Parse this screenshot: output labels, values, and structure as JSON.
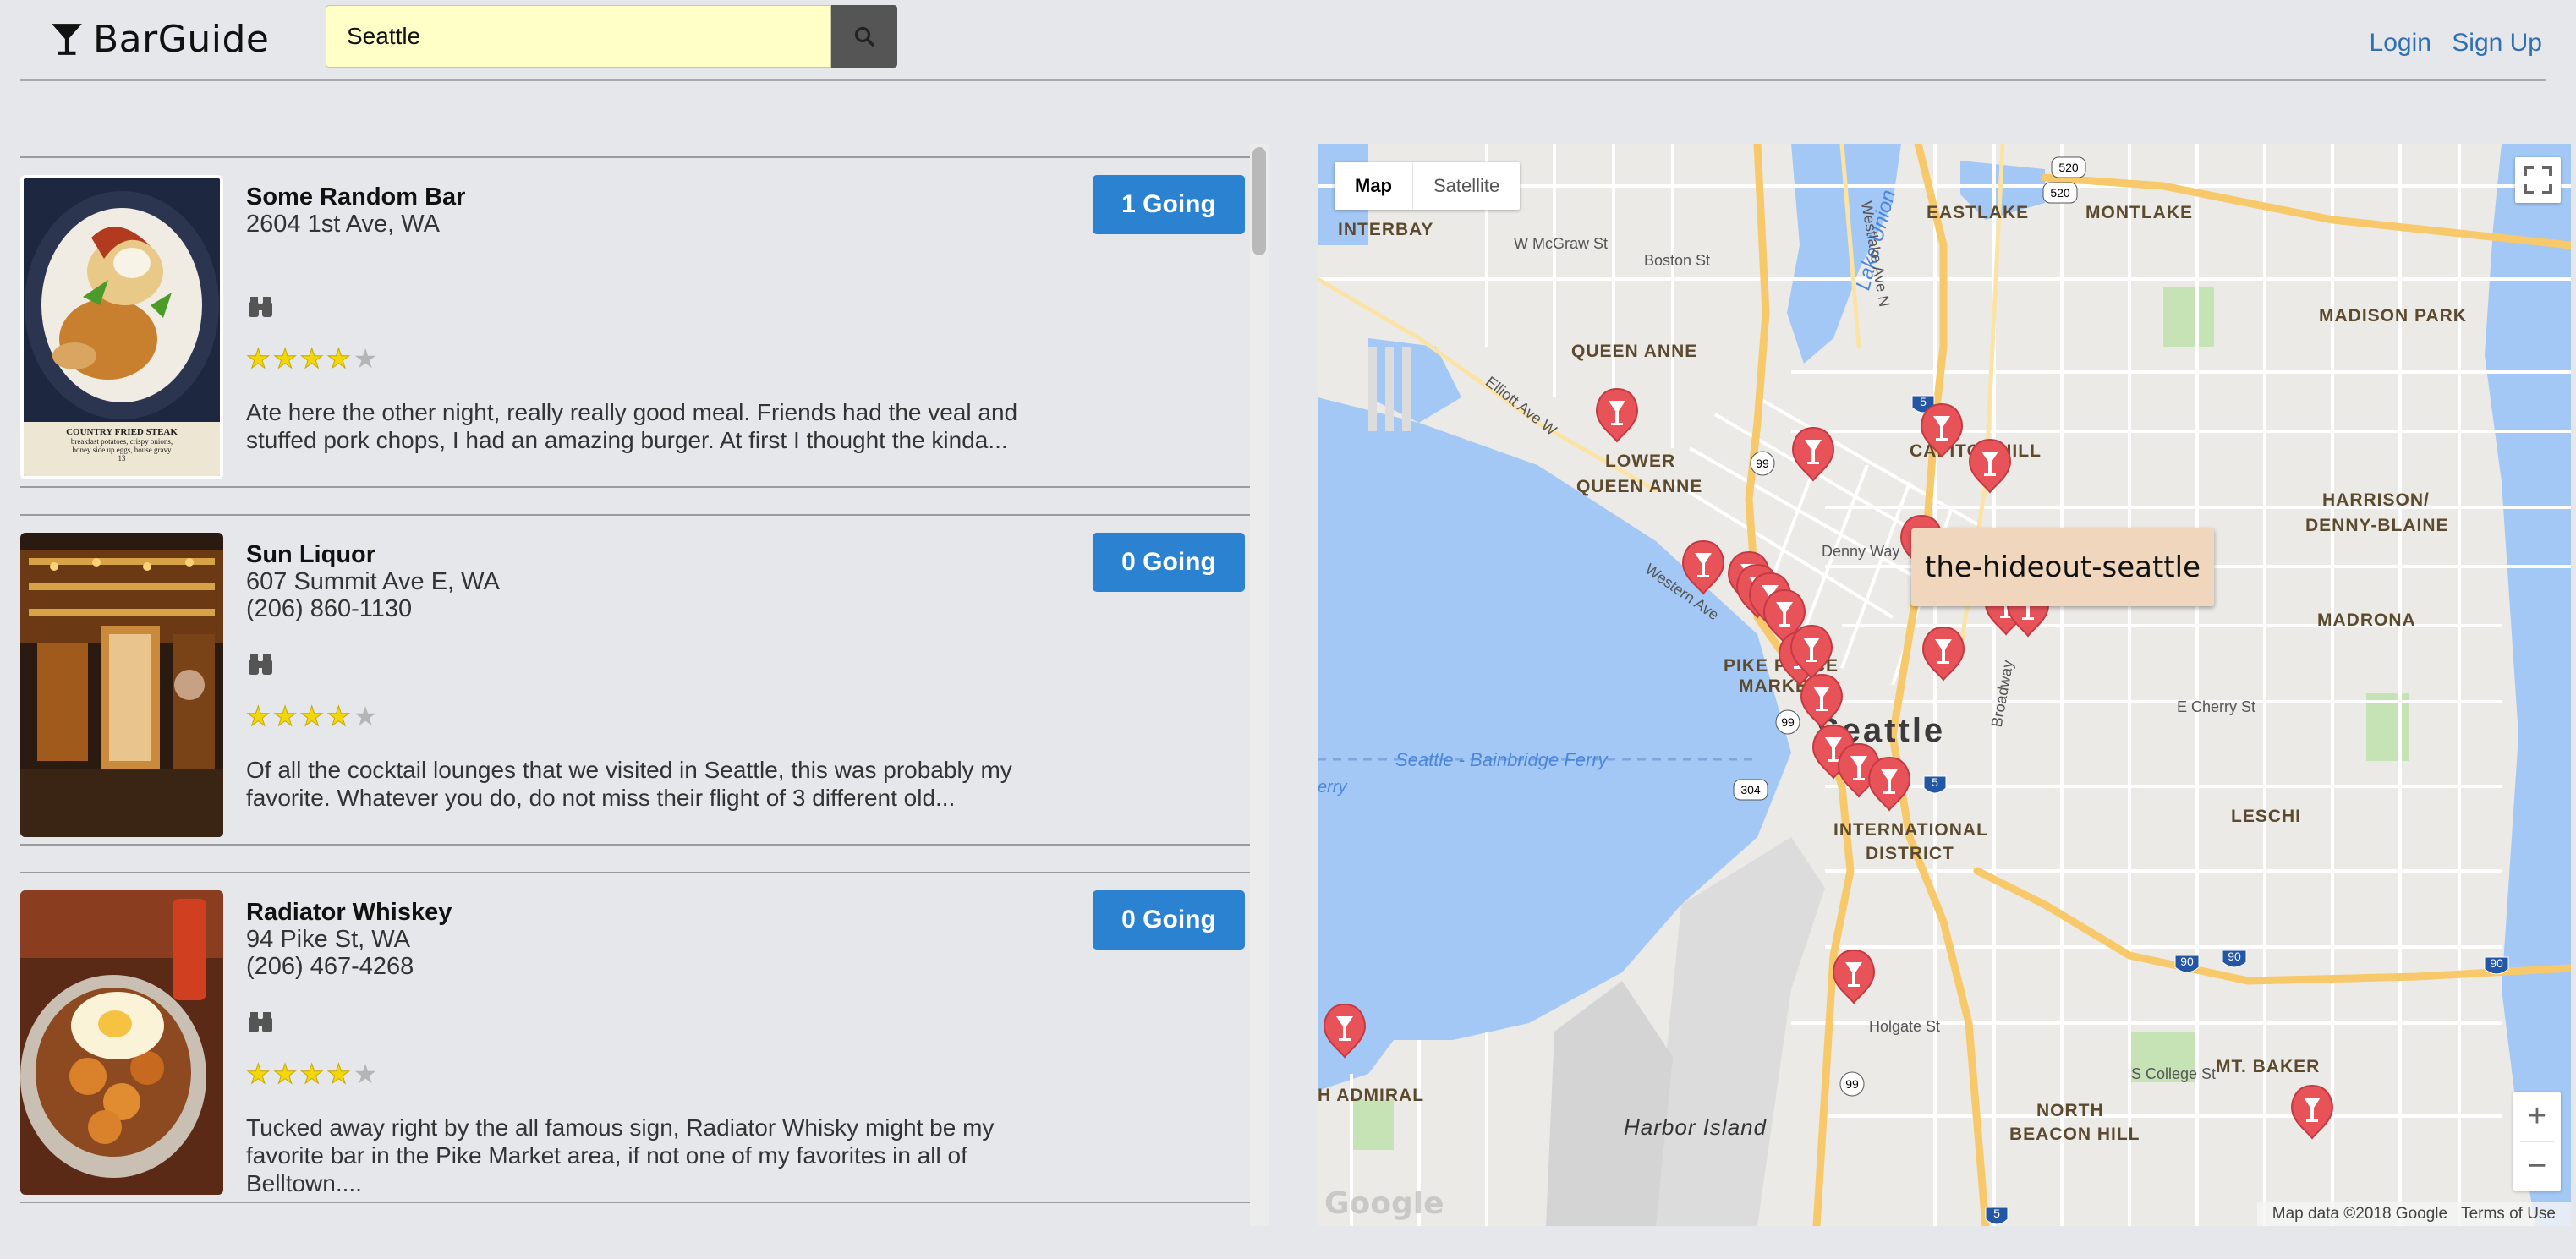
{
  "app": {
    "name": "BarGuide"
  },
  "search": {
    "value": "Seattle"
  },
  "auth": {
    "login": "Login",
    "signup": "Sign Up"
  },
  "bars": [
    {
      "name": "Some Random Bar",
      "address": "2604 1st Ave, WA",
      "phone": "",
      "going": "1 Going",
      "rating": 4,
      "review": "Ate here the other night, really really good meal. Friends had the veal and stuffed pork chops, I had an amazing burger. At first I thought the kinda...",
      "photo_caption": [
        "COUNTRY FRIED STEAK",
        "breakfast potatoes, crispy onions,",
        "honey side up eggs, house gravy",
        "13"
      ]
    },
    {
      "name": "Sun Liquor",
      "address": "607 Summit Ave E, WA",
      "phone": "(206) 860-1130",
      "going": "0 Going",
      "rating": 4,
      "review": "Of all the cocktail lounges that we visited in Seattle, this was probably my favorite. Whatever you do, do not miss their flight of 3 different old..."
    },
    {
      "name": "Radiator Whiskey",
      "address": "94 Pike St, WA",
      "phone": "(206) 467-4268",
      "going": "0 Going",
      "rating": 4,
      "review": "Tucked away right by the all famous sign, Radiator Whisky might be my favorite bar in the Pike Market area, if not one of my favorites in all of Belltown...."
    }
  ],
  "map": {
    "type_map": "Map",
    "type_satellite": "Satellite",
    "tooltip": "the-hideout-seattle",
    "attribution": "Map data ©2018 Google",
    "terms": "Terms of Use",
    "google": "Google",
    "labels": {
      "interbay": "INTERBAY",
      "eastlake": "EASTLAKE",
      "montlake": "MONTLAKE",
      "madison_park": "MADISON PARK",
      "queen_anne": "QUEEN ANNE",
      "lower_queen_anne_1": "LOWER",
      "lower_queen_anne_2": "QUEEN ANNE",
      "capitol_hill": "CAPITOL HILL",
      "harrison_1": "HARRISON/",
      "harrison_2": "DENNY-BLAINE",
      "madrona": "MADRONA",
      "pike_place_1": "PIKE PLACE",
      "pike_place_2": "MARKET",
      "seattle": "Seattle",
      "international_1": "INTERNATIONAL",
      "international_2": "DISTRICT",
      "leschi": "LESCHI",
      "mt_baker": "MT. BAKER",
      "north_beacon_1": "NORTH",
      "north_beacon_2": "BEACON HILL",
      "admiral": "H ADMIRAL",
      "harbor_island": "Harbor Island",
      "lake_union": "Lake Union",
      "ferry": "Seattle - Bainbridge Ferry",
      "ferry_left": "erry",
      "denny_way": "Denny Way",
      "boston_st": "Boston St",
      "mcgraw": "W McGraw St",
      "holgate": "Holgate St",
      "cherry": "E Cherry St",
      "college": "S College St",
      "western": "Western Ave",
      "elliott": "Elliott Ave W",
      "broadway": "Broadway",
      "eastlake_ave": "Eastlake Ave N",
      "westlake_ave": "Westlake Ave N"
    },
    "shields": [
      "520",
      "520",
      "5",
      "99",
      "99",
      "304",
      "5",
      "99",
      "90",
      "90",
      "90",
      "5"
    ]
  }
}
